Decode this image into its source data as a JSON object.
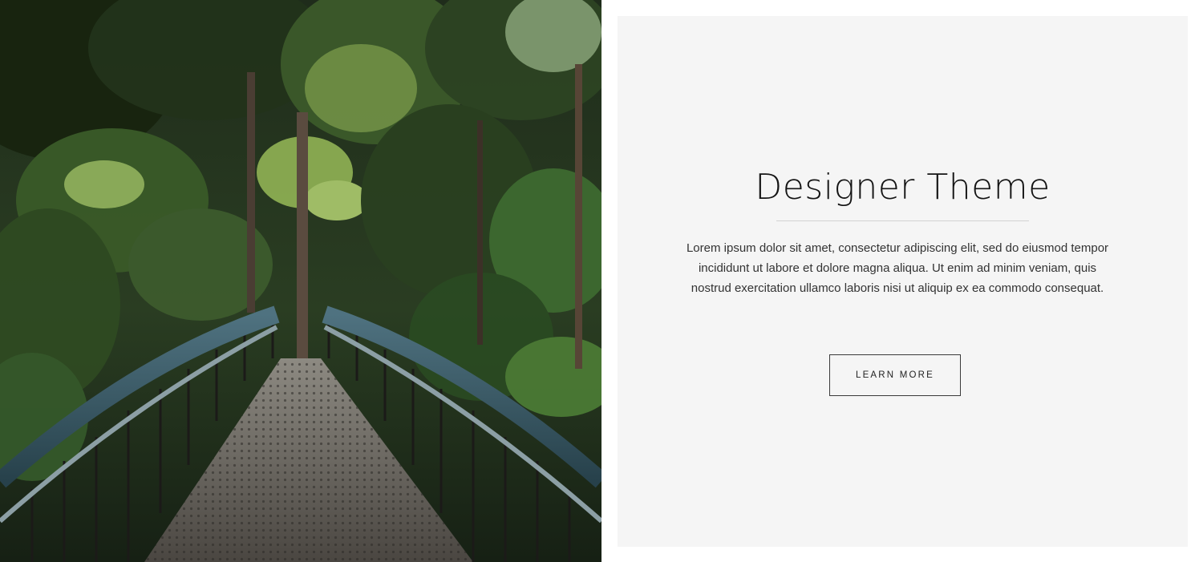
{
  "hero_image": {
    "subject": "forest footbridge"
  },
  "content": {
    "title": "Designer Theme",
    "body": "Lorem ipsum dolor sit amet, consectetur adipiscing elit, sed do eiusmod tempor incididunt ut labore et dolore magna aliqua. Ut enim ad minim veniam, quis nostrud exercitation ullamco laboris nisi ut aliquip ex ea commodo consequat.",
    "button_label": "LEARN MORE"
  },
  "colors": {
    "page_background": "#ffffff",
    "card_background": "#f5f5f5",
    "title_text": "#141414",
    "body_text": "#333333",
    "divider": "#d2d2d2",
    "button_border": "#3a3a3a"
  }
}
